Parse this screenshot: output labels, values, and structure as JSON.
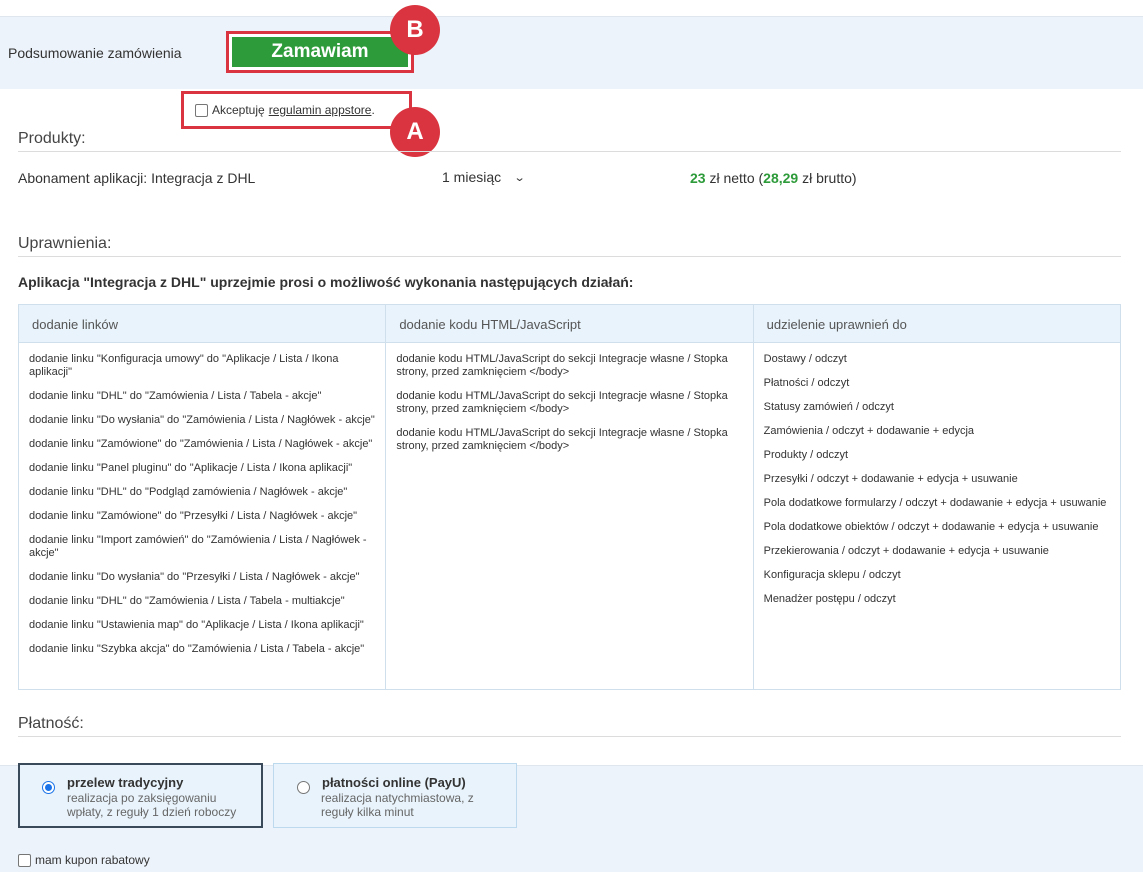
{
  "header": {
    "summary_label": "Podsumowanie zamówienia",
    "order_button": "Zamawiam",
    "badge_b": "B",
    "badge_a": "A"
  },
  "terms": {
    "prefix": "Akceptuję",
    "link": "regulamin appstore",
    "suffix": "."
  },
  "products": {
    "title": "Produkty:",
    "name": "Abonament aplikacji: Integracja z DHL",
    "period": "1 miesiąc",
    "price_net": "23",
    "price_net_suffix": " zł netto (",
    "price_gross": "28,29",
    "price_gross_suffix": " zł brutto)"
  },
  "permissions": {
    "title": "Uprawnienia:",
    "intro": "Aplikacja \"Integracja z DHL\" uprzejmie prosi o możliwość wykonania następujących działań:",
    "columns": [
      {
        "header": "dodanie linków",
        "items": [
          "dodanie linku \"Konfiguracja umowy\" do \"Aplikacje / Lista / Ikona aplikacji\"",
          "dodanie linku \"DHL\" do \"Zamówienia / Lista / Tabela - akcje\"",
          "dodanie linku \"Do wysłania\" do \"Zamówienia / Lista / Nagłówek - akcje\"",
          "dodanie linku \"Zamówione\" do \"Zamówienia / Lista / Nagłówek - akcje\"",
          "dodanie linku \"Panel pluginu\" do \"Aplikacje / Lista / Ikona aplikacji\"",
          "dodanie linku \"DHL\" do \"Podgląd zamówienia / Nagłówek - akcje\"",
          "dodanie linku \"Zamówione\" do \"Przesyłki / Lista / Nagłówek - akcje\"",
          "dodanie linku \"Import zamówień\" do \"Zamówienia / Lista / Nagłówek - akcje\"",
          "dodanie linku \"Do wysłania\" do \"Przesyłki / Lista / Nagłówek - akcje\"",
          "dodanie linku \"DHL\" do \"Zamówienia / Lista / Tabela - multiakcje\"",
          "dodanie linku \"Ustawienia map\" do \"Aplikacje / Lista / Ikona aplikacji\"",
          "dodanie linku \"Szybka akcja\" do \"Zamówienia / Lista / Tabela - akcje\""
        ]
      },
      {
        "header": "dodanie kodu HTML/JavaScript",
        "items": [
          "dodanie kodu HTML/JavaScript do sekcji Integracje własne / Stopka strony, przed zamknięciem </body>",
          "dodanie kodu HTML/JavaScript do sekcji Integracje własne / Stopka strony, przed zamknięciem </body>",
          "dodanie kodu HTML/JavaScript do sekcji Integracje własne / Stopka strony, przed zamknięciem </body>"
        ]
      },
      {
        "header": "udzielenie uprawnień do",
        "items": [
          "Dostawy / odczyt",
          "Płatności / odczyt",
          "Statusy zamówień / odczyt",
          "Zamówienia / odczyt + dodawanie + edycja",
          "Produkty / odczyt",
          "Przesyłki / odczyt + dodawanie + edycja + usuwanie",
          "Pola dodatkowe formularzy / odczyt + dodawanie + edycja + usuwanie",
          "Pola dodatkowe obiektów / odczyt + dodawanie + edycja + usuwanie",
          "Przekierowania / odczyt + dodawanie + edycja + usuwanie",
          "Konfiguracja sklepu / odczyt",
          "Menadżer postępu / odczyt"
        ]
      }
    ]
  },
  "payment": {
    "title": "Płatność:",
    "options": [
      {
        "title": "przelew tradycyjny",
        "description": "realizacja po zaksięgowaniu wpłaty, z reguły 1 dzień roboczy",
        "selected": true
      },
      {
        "title": "płatności online (PayU)",
        "description": "realizacja natychmiastowa, z reguły kilka minut",
        "selected": false
      }
    ],
    "coupon_label": "mam kupon rabatowy"
  },
  "colors": {
    "accent_green": "#2e9b3a",
    "highlight_red": "#d9343f",
    "band_blue": "#edf3fa"
  }
}
